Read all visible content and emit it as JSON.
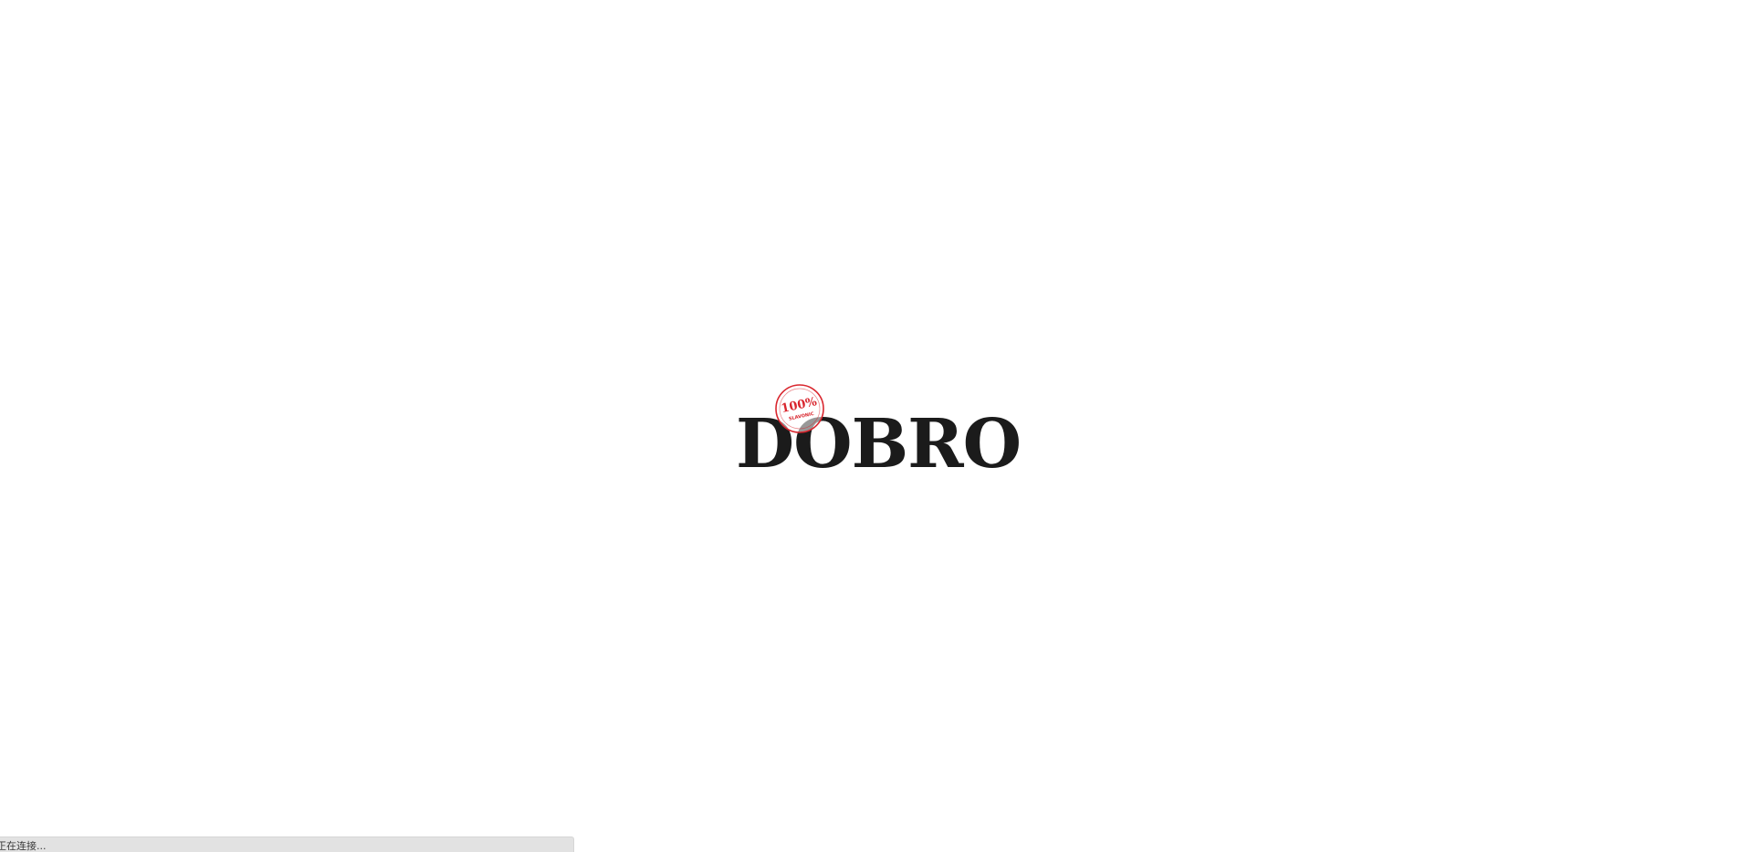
{
  "logo": {
    "wordmark": "DOBRO",
    "stamp_top": "100%",
    "stamp_bottom": "SLAVONIC",
    "stamp_color": "#d9262e",
    "text_color": "#1b1b1b"
  },
  "status_bar": {
    "text": "正在连接..."
  }
}
